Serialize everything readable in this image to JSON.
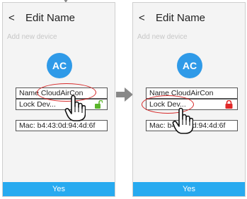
{
  "colors": {
    "accent": "#27aaf0",
    "badge": "#2f9ae8",
    "highlight": "#d62828",
    "lock_unlocked": "#5ab52a",
    "lock_locked": "#e02828",
    "arrow": "#888888"
  },
  "left_screen": {
    "back_label": "<",
    "title": "Edit Name",
    "subtitle": "Add new device",
    "badge": "AC",
    "name_field": "Name CloudAirCon",
    "lock_field": "Lock Dev...",
    "lock_state": "unlocked",
    "mac_field": "Mac: b4:43:0d:94:4d:6f",
    "yes_label": "Yes"
  },
  "right_screen": {
    "back_label": "<",
    "title": "Edit Name",
    "subtitle": "Add new device",
    "badge": "AC",
    "name_field": "Name CloudAirCon",
    "lock_field": "Lock Dev...",
    "lock_state": "locked",
    "mac_field": "Mac: b4:43:0d:94:4d:6f",
    "yes_label": "Yes"
  },
  "icons": [
    "back-icon",
    "lock-open-icon",
    "lock-closed-icon",
    "hand-pointer-icon",
    "arrow-right-icon",
    "arrow-down-icon"
  ]
}
